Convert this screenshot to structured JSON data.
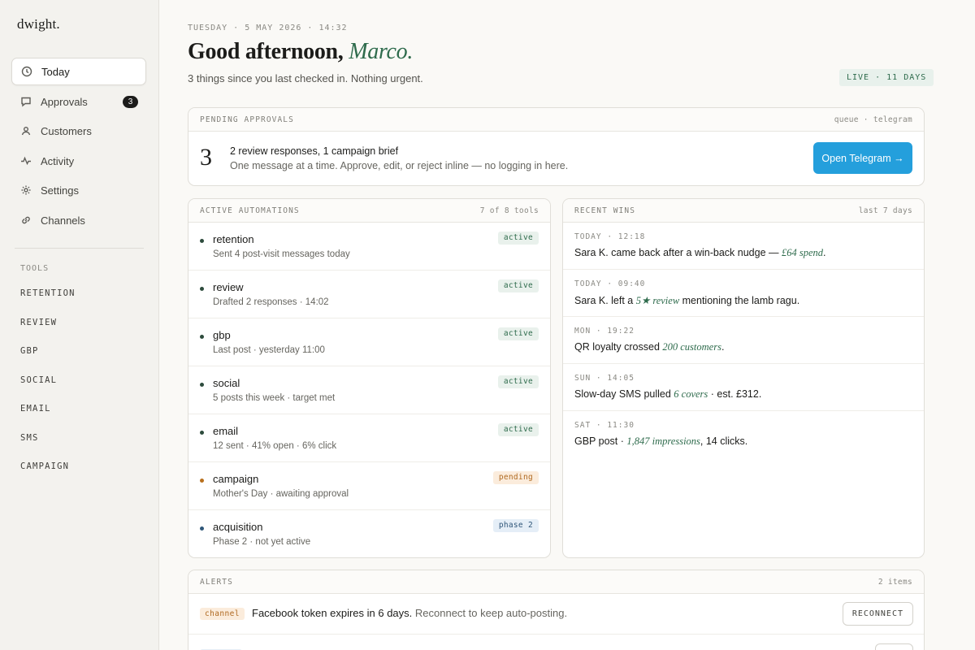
{
  "brand": "dwight.",
  "nav": [
    {
      "label": "Today",
      "icon": "clock-icon"
    },
    {
      "label": "Approvals",
      "icon": "message-icon",
      "badge": "3"
    },
    {
      "label": "Customers",
      "icon": "person-icon"
    },
    {
      "label": "Activity",
      "icon": "pulse-icon"
    },
    {
      "label": "Settings",
      "icon": "gear-icon"
    },
    {
      "label": "Channels",
      "icon": "link-icon"
    }
  ],
  "tools": {
    "heading": "TOOLS",
    "items": [
      "RETENTION",
      "REVIEW",
      "GBP",
      "SOCIAL",
      "EMAIL",
      "SMS",
      "CAMPAIGN"
    ]
  },
  "header": {
    "dateline": "TUESDAY · 5 MAY 2026 · 14:32",
    "greeting": "Good afternoon,",
    "name": "Marco.",
    "subline": "3 things since you last checked in. Nothing urgent.",
    "live": "LIVE · 11 DAYS"
  },
  "pending": {
    "title": "PENDING APPROVALS",
    "meta": "queue · telegram",
    "count": "3",
    "summary": "2 review responses, 1 campaign brief",
    "description": "One message at a time. Approve, edit, or reject inline — no logging in here.",
    "button": "Open Telegram →"
  },
  "automations": {
    "title": "ACTIVE AUTOMATIONS",
    "meta": "7 of 8 tools",
    "rows": [
      {
        "name": "retention",
        "desc": "Sent 4 post-visit messages today",
        "status": "active"
      },
      {
        "name": "review",
        "desc": "Drafted 2 responses · 14:02",
        "status": "active"
      },
      {
        "name": "gbp",
        "desc": "Last post · yesterday 11:00",
        "status": "active"
      },
      {
        "name": "social",
        "desc": "5 posts this week · target met",
        "status": "active"
      },
      {
        "name": "email",
        "desc": "12 sent · 41% open · 6% click",
        "status": "active"
      },
      {
        "name": "campaign",
        "desc": "Mother's Day · awaiting approval",
        "status": "pending"
      },
      {
        "name": "acquisition",
        "desc": "Phase 2 · not yet active",
        "status": "phase 2"
      }
    ]
  },
  "wins": {
    "title": "RECENT WINS",
    "meta": "last 7 days",
    "rows": [
      {
        "time": "TODAY · 12:18",
        "pre": "Sara K. came back after a win-back nudge — ",
        "hl": "£64 spend",
        "post": "."
      },
      {
        "time": "TODAY · 09:40",
        "pre": "Sara K. left a ",
        "hl": "5★ review",
        "post": " mentioning the lamb ragu."
      },
      {
        "time": "MON · 19:22",
        "pre": "QR loyalty crossed ",
        "hl": "200 customers",
        "post": "."
      },
      {
        "time": "SUN · 14:05",
        "pre": "Slow-day SMS pulled ",
        "hl": "6 covers",
        "post": " · est. £312."
      },
      {
        "time": "SAT · 11:30",
        "pre": "GBP post · ",
        "hl": "1,847 impressions",
        "post": ", 14 clicks."
      }
    ]
  },
  "alerts": {
    "title": "ALERTS",
    "meta": "2 items",
    "rows": [
      {
        "tag": "channel",
        "strong": "Facebook token expires in 6 days.",
        "soft": " Reconnect to keep auto-posting.",
        "button": "RECONNECT"
      }
    ]
  },
  "colors": {
    "accent_green": "#2e6b4c",
    "telegram_blue": "#249fdc",
    "pending_orange": "#b06a22"
  }
}
